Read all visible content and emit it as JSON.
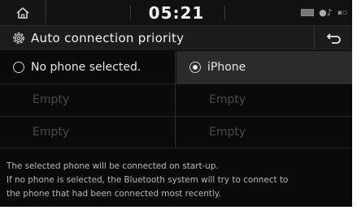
{
  "status_bar": {
    "time": "05:21",
    "icons": [
      "home-icon",
      "battery-icon",
      "bluetooth-audio-icon",
      "signal-icon"
    ]
  },
  "header": {
    "title": "Auto connection priority",
    "icons": [
      "gear-icon",
      "back-arrow-icon"
    ]
  },
  "options": [
    {
      "label": "No phone selected.",
      "selected": false
    },
    {
      "label": "iPhone",
      "selected": true
    },
    {
      "label": "Empty",
      "selected": false
    },
    {
      "label": "Empty",
      "selected": false
    },
    {
      "label": "Empty",
      "selected": false
    },
    {
      "label": "Empty",
      "selected": false
    }
  ],
  "description": {
    "line1": "The selected phone will be connected on start-up.",
    "line2": "If no phone is selected, the Bluetooth system will try to connect to",
    "line3": "the phone that had been connected most recently."
  },
  "colors": {
    "background": "#0a0a0a",
    "selected_cell": "#2b2b2b",
    "text": "#e6e6e6",
    "muted_text": "#4a4a4a"
  }
}
